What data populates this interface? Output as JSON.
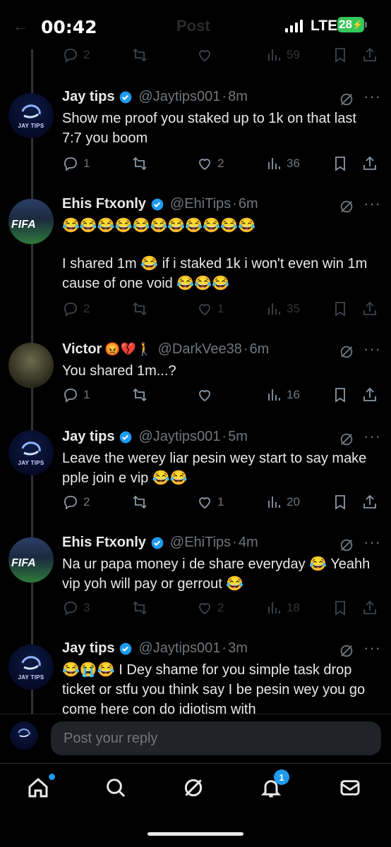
{
  "status_bar": {
    "time": "00:42",
    "title_dim": "Post",
    "network": "LTE",
    "battery": "28"
  },
  "top_actions": {
    "reply": "2",
    "repost": "",
    "like": "",
    "views": "59"
  },
  "tweets": [
    {
      "name": "Jay tips",
      "handle": "@Jaytips001",
      "time": "8m",
      "text": "Show me proof you staked up to 1k on that last 7:7 you boom",
      "reply": "1",
      "repost": "",
      "like": "2",
      "views": "36",
      "avatar_text": "JAY TIPS"
    },
    {
      "name": "Ehis Ftxonly",
      "handle": "@EhiTips",
      "time": "6m",
      "emoji_line": "😂😂😂😂😂😂😂😂😂😂😂",
      "text": "I shared 1m 😂 if i staked 1k i won't even win 1m cause of one void 😂😂😂",
      "reply": "2",
      "repost": "",
      "like": "1",
      "views": "35",
      "avatar_text": "FIFA"
    },
    {
      "name": "Victor",
      "name_emoji": "😡💔🚶",
      "handle": "@DarkVee38",
      "time": "6m",
      "text": "You shared 1m...?",
      "reply": "1",
      "repost": "",
      "like": "",
      "views": "16"
    },
    {
      "name": "Jay tips",
      "handle": "@Jaytips001",
      "time": "5m",
      "text": "Leave the werey liar pesin wey start to say make pple join e vip 😂😂",
      "reply": "2",
      "repost": "",
      "like": "1",
      "views": "20",
      "avatar_text": "JAY TIPS"
    },
    {
      "name": "Ehis Ftxonly",
      "handle": "@EhiTips",
      "time": "4m",
      "text": "Na ur papa money i de share everyday 😂 Yeahh vip yoh will pay or gerrout 😂",
      "reply": "3",
      "repost": "",
      "like": "2",
      "views": "18",
      "avatar_text": "FIFA"
    },
    {
      "name": "Jay tips",
      "handle": "@Jaytips001",
      "time": "3m",
      "text": "😂😭😂 I Dey shame for you simple task drop ticket or stfu you think say I be pesin wey you go come here con do idiotism with",
      "avatar_text": "JAY TIPS"
    }
  ],
  "reply_bar": {
    "placeholder": "Post your reply"
  },
  "bottom_nav": {
    "notification_count": "1"
  },
  "colors": {
    "background": "#000000",
    "accent": "#1d9bf0",
    "muted": "#71767b",
    "battery": "#34c759"
  }
}
